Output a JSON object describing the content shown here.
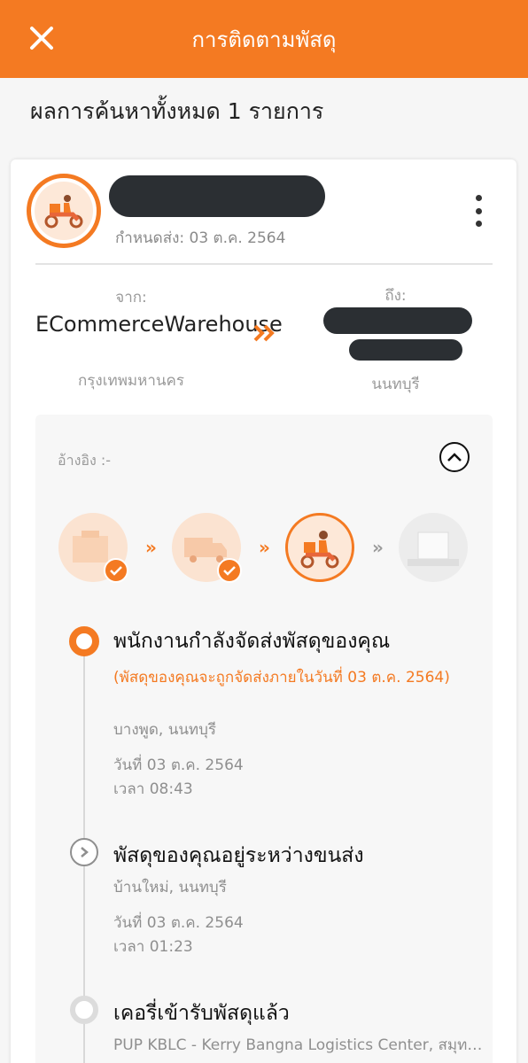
{
  "app_bar": {
    "title": "การติดตามพัสดุ",
    "close_icon": "close-icon"
  },
  "summary": "ผลการค้นหาทั้งหมด 1 รายการ",
  "shipment": {
    "due_date": "กำหนดส่ง: 03 ต.ค. 2564",
    "from_label": "จาก:",
    "from_name": "ECommerceWarehouse",
    "from_city": "กรุงเทพมหานคร",
    "to_label": "ถึง:",
    "to_city": "นนทบุรี"
  },
  "panel": {
    "reference": "อ้างอิง :-",
    "progress_steps": [
      {
        "icon": "package-icon",
        "done": true
      },
      {
        "icon": "truck-icon",
        "done": true
      },
      {
        "icon": "courier-scooter-icon",
        "done": false,
        "current": true
      },
      {
        "icon": "delivered-box-icon",
        "done": false
      }
    ]
  },
  "timeline": [
    {
      "title": "พนักงานกำลังจัดส่งพัสดุของคุณ",
      "note": "(พัสดุของคุณจะถูกจัดส่งภายในวันที่ 03 ต.ค. 2564)",
      "location": "บางพูด, นนทบุรี",
      "date": "วันที่ 03 ต.ค. 2564",
      "time": "เวลา 08:43"
    },
    {
      "title": "พัสดุของคุณอยู่ระหว่างขนส่ง",
      "location": "บ้านใหม่, นนทบุรี",
      "date": "วันที่ 03 ต.ค. 2564",
      "time": "เวลา 01:23"
    },
    {
      "title": "เคอรี่เข้ารับพัสดุแล้ว",
      "location": "PUP KBLC - Kerry Bangna Logistics Center, สมุทรปราการ"
    }
  ],
  "colors": {
    "accent": "#f47a22",
    "redacted": "#2b2f33"
  }
}
